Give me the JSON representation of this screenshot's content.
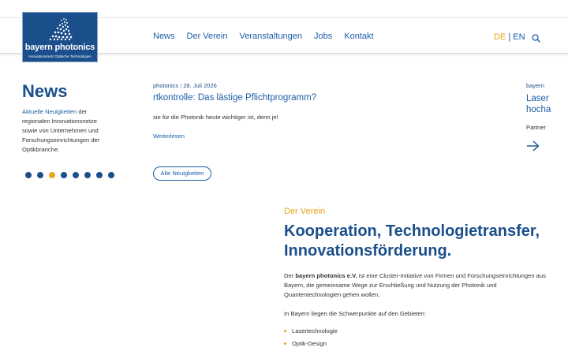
{
  "logo": {
    "name": "bayern photonics",
    "tagline": "Innovationsnetz Optische Technologien"
  },
  "nav": {
    "items": [
      "News",
      "Der Verein",
      "Veranstaltungen",
      "Jobs",
      "Kontakt"
    ]
  },
  "lang": {
    "de": "DE",
    "separator": "|",
    "en": "EN"
  },
  "news": {
    "title": "News",
    "desc_highlight": "Aktuelle Neuigkeiten",
    "desc_rest": " der regionalen Innovationsnetze sowie von Unternehmen und Forschungseinrichtungen der Optikbranche.",
    "dots": 8,
    "active_dot": 2
  },
  "card": {
    "category": "photonics",
    "separator": "|",
    "date": "28. Juli 2026",
    "title": "rtkontrolle: Das lästige Pflichtprogramm?",
    "text": "sie für die Photonik heute wichtiger ist, denn je!",
    "link": "Weiterlesen"
  },
  "all_news_button": "Alle Neuigkeiten",
  "peek_card": {
    "category": "bayern",
    "title_line1": "Laser",
    "title_line2": "hocha",
    "partner": "Partner"
  },
  "verein": {
    "eyebrow": "Der Verein",
    "title": "Kooperation, Technologietransfer, Innovationsförderung.",
    "p1_prefix": "Der ",
    "p1_bold": "bayern photonics e.V.",
    "p1_rest": " ist eine Cluster-Initiative von Firmen und Forschungseinrichtungen aus Bayern, die gemeinsame Wege zur Erschließung und Nutzung der Photonik und Quantentechnologien gehen wollen.",
    "p2": "In Bayern liegen die Schwerpunkte auf den Gebieten:",
    "bullets": [
      "Lasertechnologie",
      "Optik-Design"
    ]
  },
  "colors": {
    "brand_blue": "#1b4f8c",
    "link_blue": "#1b5da8",
    "accent_orange": "#e8a317"
  },
  "icons": [
    "search-icon",
    "arrow-right-icon",
    "logo-dots-icon"
  ]
}
